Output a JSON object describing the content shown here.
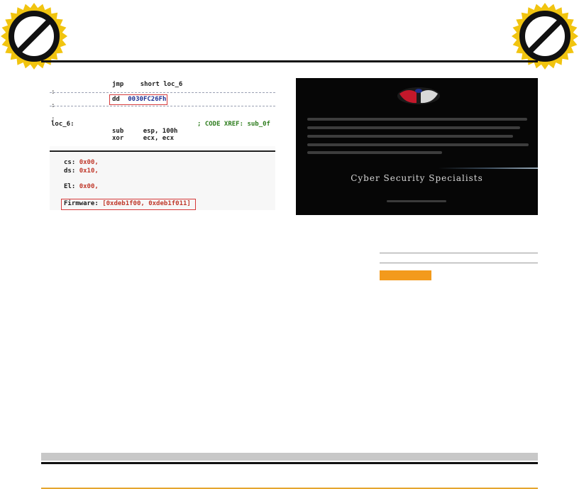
{
  "colors": {
    "badge_gold": "#f1c40f",
    "badge_ring": "#111111",
    "code_green": "#2e7d1e",
    "code_blue": "#1d2f91",
    "highlight_red": "#d63a3a",
    "accent_orange": "#f39a1c",
    "footer_gold": "#e4a62e"
  },
  "icons": {
    "left_badge": "prohibition-icon",
    "right_badge": "prohibition-icon"
  },
  "code": {
    "line1_mnemonic": "jmp",
    "line1_operand": "short loc_6",
    "line2_mnemonic": "dd",
    "line2_operand": "0030FC26Fh",
    "label": "loc_6:",
    "xref": "; CODE XREF: sub_0f",
    "line3_mnemonic": "sub",
    "line3_operand": "esp, 100h",
    "line4_mnemonic": "xor",
    "line4_operand": "ecx, ecx",
    "reg1_name": "cs:",
    "reg1_value": "0x00,",
    "reg2_name": "ds:",
    "reg2_value": "0x10,",
    "reg3_name": "El:",
    "reg3_value": "0x00,",
    "firmware_name": "Firmware:",
    "firmware_value": "[0xdeb1f00, 0xdeb1f011]"
  },
  "website": {
    "tagline": "Cyber Security Specialists"
  }
}
